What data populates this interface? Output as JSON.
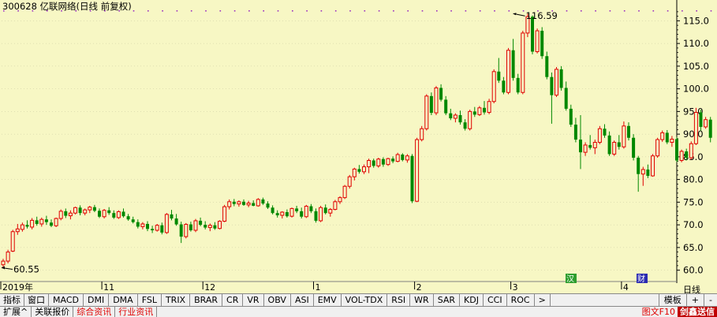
{
  "header": {
    "title": "300628 亿联网络(日线 前复权)"
  },
  "chart_data": {
    "type": "candlestick",
    "ylim": [
      57.5,
      117.5
    ],
    "y_ticks": [
      "115.0",
      "110.0",
      "105.0",
      "100.0",
      "95.0",
      "90.0",
      "85.0",
      "80.0",
      "75.0",
      "70.0",
      "65.0",
      "60.0"
    ],
    "x_labels": [
      {
        "label": "2019年",
        "index": 0
      },
      {
        "label": "11",
        "index": 21
      },
      {
        "label": "12",
        "index": 42
      },
      {
        "label": "1",
        "index": 65
      },
      {
        "label": "2",
        "index": 86
      },
      {
        "label": "3",
        "index": 106
      },
      {
        "label": "4",
        "index": 129
      }
    ],
    "max_annotation": {
      "text": "116.59",
      "index": 106,
      "value": 116.59
    },
    "min_annotation": {
      "text": "60.55",
      "index": 0,
      "value": 60.55
    },
    "candles": [
      [
        61.2,
        62.5,
        60.55,
        62.0
      ],
      [
        62.0,
        64.5,
        61.5,
        64.0
      ],
      [
        64.2,
        68.9,
        64.0,
        68.5
      ],
      [
        68.5,
        70.2,
        67.8,
        69.1
      ],
      [
        69.0,
        70.5,
        68.5,
        70.0
      ],
      [
        70.0,
        71.0,
        69.2,
        69.6
      ],
      [
        69.5,
        71.5,
        69.0,
        71.0
      ],
      [
        71.0,
        71.8,
        69.8,
        70.2
      ],
      [
        70.2,
        71.6,
        69.6,
        71.2
      ],
      [
        71.2,
        72.0,
        70.0,
        70.6
      ],
      [
        70.5,
        71.2,
        69.5,
        69.8
      ],
      [
        69.8,
        71.6,
        69.5,
        71.4
      ],
      [
        71.4,
        73.4,
        71.0,
        73.0
      ],
      [
        73.0,
        73.6,
        71.5,
        72.0
      ],
      [
        72.0,
        73.2,
        71.2,
        72.6
      ],
      [
        72.6,
        74.0,
        72.3,
        73.8
      ],
      [
        73.8,
        74.3,
        72.1,
        72.6
      ],
      [
        72.6,
        73.6,
        72.1,
        73.3
      ],
      [
        73.3,
        74.2,
        72.6,
        73.9
      ],
      [
        73.9,
        74.4,
        72.8,
        73.1
      ],
      [
        73.1,
        73.6,
        71.5,
        71.8
      ],
      [
        71.8,
        73.5,
        71.4,
        73.2
      ],
      [
        73.2,
        73.9,
        72.2,
        72.6
      ],
      [
        72.6,
        73.2,
        71.3,
        71.6
      ],
      [
        71.6,
        73.2,
        71.3,
        72.9
      ],
      [
        72.9,
        73.6,
        71.6,
        71.9
      ],
      [
        71.9,
        72.4,
        70.9,
        71.2
      ],
      [
        71.2,
        71.8,
        70.3,
        70.6
      ],
      [
        70.6,
        71.2,
        69.2,
        69.6
      ],
      [
        69.6,
        70.6,
        69.0,
        70.2
      ],
      [
        70.2,
        70.8,
        68.6,
        69.1
      ],
      [
        69.1,
        69.8,
        68.2,
        68.8
      ],
      [
        68.8,
        70.2,
        68.5,
        69.9
      ],
      [
        69.9,
        70.5,
        67.9,
        68.3
      ],
      [
        68.3,
        72.6,
        68.0,
        72.3
      ],
      [
        72.3,
        73.3,
        71.0,
        71.4
      ],
      [
        71.4,
        72.4,
        69.8,
        70.1
      ],
      [
        70.1,
        70.7,
        66.0,
        67.4
      ],
      [
        67.4,
        70.4,
        67.0,
        70.1
      ],
      [
        70.1,
        70.7,
        68.5,
        68.8
      ],
      [
        68.8,
        71.3,
        68.4,
        70.9
      ],
      [
        70.9,
        71.6,
        69.7,
        70.0
      ],
      [
        70.0,
        70.8,
        69.0,
        69.4
      ],
      [
        69.4,
        70.3,
        68.6,
        69.9
      ],
      [
        69.9,
        70.6,
        68.9,
        69.2
      ],
      [
        69.2,
        71.0,
        69.0,
        70.8
      ],
      [
        70.8,
        74.4,
        70.6,
        74.0
      ],
      [
        74.0,
        75.6,
        73.4,
        75.1
      ],
      [
        75.1,
        75.7,
        74.1,
        74.6
      ],
      [
        74.6,
        75.4,
        74.0,
        75.1
      ],
      [
        75.1,
        75.6,
        74.2,
        74.4
      ],
      [
        74.4,
        75.3,
        73.9,
        74.8
      ],
      [
        74.8,
        75.4,
        74.1,
        74.2
      ],
      [
        74.2,
        75.9,
        74.0,
        75.6
      ],
      [
        75.6,
        76.0,
        74.4,
        74.7
      ],
      [
        74.7,
        75.2,
        73.5,
        73.8
      ],
      [
        73.8,
        74.3,
        72.3,
        72.6
      ],
      [
        72.6,
        73.2,
        71.6,
        72.1
      ],
      [
        72.1,
        73.0,
        71.4,
        72.8
      ],
      [
        72.8,
        73.4,
        71.6,
        71.9
      ],
      [
        71.9,
        73.8,
        71.6,
        73.6
      ],
      [
        73.6,
        74.2,
        72.6,
        73.0
      ],
      [
        73.0,
        73.8,
        71.4,
        71.8
      ],
      [
        71.8,
        74.4,
        71.5,
        74.1
      ],
      [
        74.1,
        74.6,
        72.6,
        73.0
      ],
      [
        73.0,
        73.6,
        70.5,
        70.9
      ],
      [
        70.9,
        74.2,
        70.6,
        73.8
      ],
      [
        73.8,
        74.5,
        72.3,
        72.6
      ],
      [
        72.6,
        73.7,
        71.8,
        73.4
      ],
      [
        73.4,
        75.5,
        73.2,
        75.1
      ],
      [
        75.1,
        76.3,
        74.6,
        76.0
      ],
      [
        76.0,
        78.8,
        75.7,
        78.5
      ],
      [
        78.5,
        81.0,
        78.0,
        80.6
      ],
      [
        80.6,
        82.6,
        79.8,
        82.3
      ],
      [
        82.3,
        83.2,
        81.3,
        81.7
      ],
      [
        81.7,
        83.3,
        81.2,
        82.8
      ],
      [
        82.8,
        84.6,
        81.4,
        84.2
      ],
      [
        84.2,
        84.6,
        82.6,
        83.0
      ],
      [
        83.0,
        84.8,
        82.6,
        84.5
      ],
      [
        84.5,
        84.9,
        82.8,
        83.3
      ],
      [
        83.3,
        84.8,
        83.0,
        84.6
      ],
      [
        84.6,
        85.1,
        83.6,
        84.0
      ],
      [
        84.0,
        85.9,
        83.8,
        85.5
      ],
      [
        85.5,
        85.8,
        84.0,
        84.3
      ],
      [
        84.3,
        85.6,
        83.7,
        85.2
      ],
      [
        85.2,
        85.6,
        74.8,
        75.2
      ],
      [
        75.2,
        89.2,
        75.0,
        88.8
      ],
      [
        88.8,
        91.8,
        88.4,
        91.2
      ],
      [
        91.2,
        98.8,
        90.8,
        98.4
      ],
      [
        98.4,
        99.2,
        94.2,
        94.7
      ],
      [
        94.7,
        100.6,
        94.2,
        100.2
      ],
      [
        100.2,
        101.0,
        97.2,
        97.6
      ],
      [
        97.6,
        98.4,
        94.2,
        94.6
      ],
      [
        94.6,
        95.6,
        93.1,
        93.5
      ],
      [
        93.5,
        94.6,
        92.6,
        94.2
      ],
      [
        94.2,
        95.2,
        92.1,
        92.6
      ],
      [
        92.6,
        93.3,
        90.8,
        91.2
      ],
      [
        91.2,
        95.4,
        90.8,
        95.0
      ],
      [
        95.0,
        96.0,
        93.8,
        94.3
      ],
      [
        94.3,
        96.2,
        94.0,
        95.8
      ],
      [
        95.8,
        97.3,
        94.3,
        94.8
      ],
      [
        94.8,
        97.8,
        94.4,
        97.2
      ],
      [
        97.2,
        104.3,
        96.8,
        103.8
      ],
      [
        103.8,
        106.8,
        101.3,
        101.8
      ],
      [
        101.8,
        102.6,
        98.8,
        99.2
      ],
      [
        99.2,
        109.0,
        98.8,
        108.5
      ],
      [
        108.5,
        111.0,
        101.8,
        102.4
      ],
      [
        102.4,
        103.3,
        98.8,
        99.2
      ],
      [
        99.2,
        112.8,
        98.8,
        112.3
      ],
      [
        112.3,
        116.59,
        111.4,
        115.9
      ],
      [
        115.9,
        116.2,
        107.6,
        108.2
      ],
      [
        108.2,
        113.3,
        107.8,
        112.8
      ],
      [
        112.8,
        113.6,
        106.6,
        107.2
      ],
      [
        107.2,
        108.2,
        102.1,
        102.6
      ],
      [
        102.6,
        103.6,
        92.3,
        98.6
      ],
      [
        98.6,
        104.8,
        98.2,
        104.3
      ],
      [
        104.3,
        105.0,
        99.6,
        100.2
      ],
      [
        100.2,
        101.6,
        95.2,
        95.6
      ],
      [
        95.6,
        96.5,
        91.6,
        92.1
      ],
      [
        92.1,
        93.6,
        88.2,
        88.8
      ],
      [
        88.8,
        94.2,
        82.3,
        86.0
      ],
      [
        86.0,
        88.2,
        85.2,
        87.6
      ],
      [
        87.6,
        89.8,
        86.6,
        87.0
      ],
      [
        87.0,
        88.8,
        85.6,
        88.2
      ],
      [
        88.2,
        91.8,
        87.8,
        91.2
      ],
      [
        91.2,
        92.2,
        89.2,
        89.7
      ],
      [
        89.7,
        90.6,
        85.2,
        85.6
      ],
      [
        85.6,
        88.6,
        85.2,
        88.2
      ],
      [
        88.2,
        89.8,
        86.6,
        87.2
      ],
      [
        87.2,
        92.8,
        86.8,
        91.8
      ],
      [
        91.8,
        92.6,
        88.6,
        89.2
      ],
      [
        89.2,
        90.0,
        84.2,
        84.8
      ],
      [
        84.8,
        85.2,
        77.3,
        81.2
      ],
      [
        81.2,
        82.8,
        78.6,
        82.2
      ],
      [
        82.2,
        83.3,
        80.3,
        80.8
      ],
      [
        80.8,
        85.6,
        80.6,
        85.2
      ],
      [
        85.2,
        89.2,
        84.8,
        88.8
      ],
      [
        88.8,
        90.8,
        88.3,
        90.3
      ],
      [
        90.3,
        90.9,
        87.8,
        88.2
      ],
      [
        88.2,
        89.6,
        87.2,
        88.9
      ],
      [
        88.9,
        89.4,
        83.8,
        84.2
      ],
      [
        84.2,
        86.6,
        83.8,
        86.2
      ],
      [
        86.2,
        86.8,
        84.2,
        84.8
      ],
      [
        84.8,
        88.4,
        84.4,
        87.9
      ],
      [
        87.9,
        95.8,
        87.6,
        94.8
      ],
      [
        94.8,
        95.4,
        90.8,
        91.6
      ],
      [
        91.6,
        93.8,
        91.2,
        93.2
      ],
      [
        93.2,
        93.8,
        88.2,
        89.2
      ]
    ]
  },
  "period_label": "日线",
  "badges": [
    "汉",
    "财"
  ],
  "toolbar": {
    "tabs": [
      "指标",
      "窗口",
      "MACD",
      "DMI",
      "DMA",
      "FSL",
      "TRIX",
      "BRAR",
      "CR",
      "VR",
      "OBV",
      "ASI",
      "EMV",
      "VOL-TDX",
      "RSI",
      "WR",
      "SAR",
      "KDJ",
      "CCI",
      "ROC",
      ">"
    ],
    "template_label": "模板",
    "plus_label": "+",
    "minus_label": "-"
  },
  "bottom": {
    "tabs": [
      "扩展^",
      "关联报价",
      "综合资讯",
      "行业资讯"
    ],
    "red_tabs": [
      false,
      false,
      true,
      true
    ],
    "f10_label": "图文F10",
    "badge_label": "剑鑫送信"
  },
  "colors": {
    "background": "#f7f7c4",
    "up": "#e00000",
    "down": "#008800",
    "grid": "#c8c8a0",
    "axis": "#000000"
  }
}
